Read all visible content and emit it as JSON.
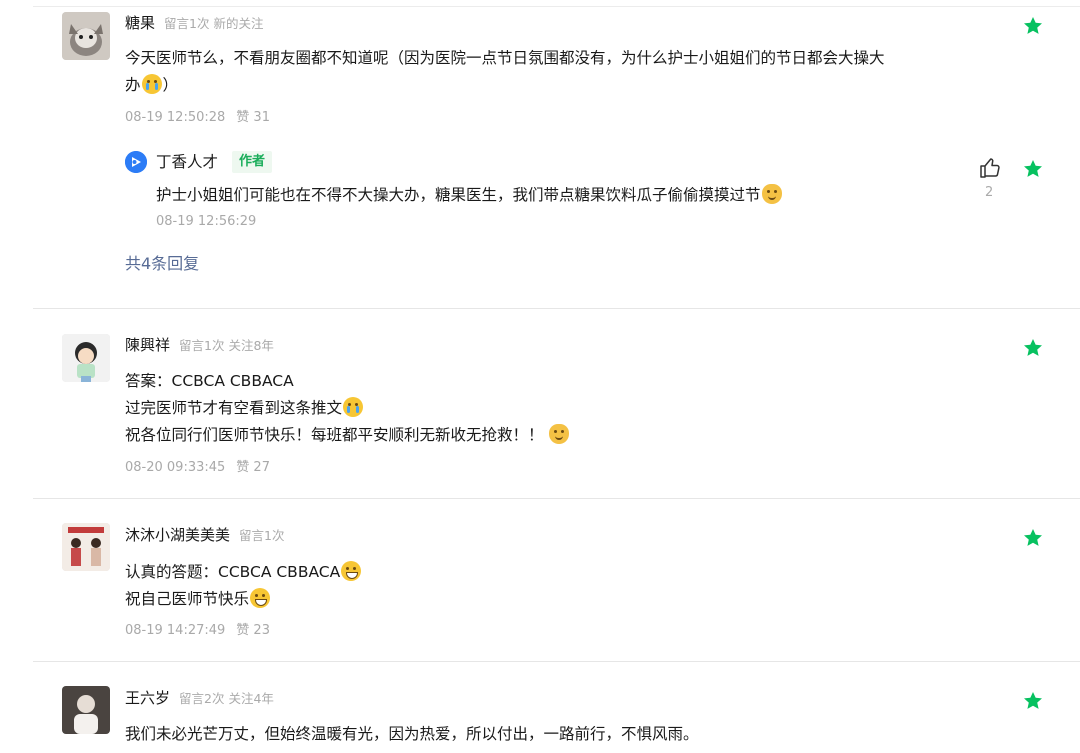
{
  "comments": [
    {
      "nickname": "糖果",
      "stat1": "留言1次",
      "stat2": "新的关注",
      "text_lines": [
        "今天医师节么，不看朋友圈都不知道呢（因为医院一点节日氛围都没有，为什么护士小姐姐们的节日都会大操大",
        "办"
      ],
      "line2_tail": "）",
      "time": "08-19 12:50:28",
      "likes": "赞 31",
      "reply": {
        "name": "丁香人才",
        "badge": "作者",
        "text": "护士小姐姐们可能也在不得不大操大办，糖果医生，我们带点糖果饮料瓜子偷偷摸摸过节",
        "time": "08-19 12:56:29",
        "like_count": "2"
      },
      "more_replies": "共4条回复"
    },
    {
      "nickname": "陳興祥",
      "stat1": "留言1次",
      "stat2": "关注8年",
      "line1": "答案：CCBCA  CBBACA",
      "line2": " 过完医师节才有空看到这条推文",
      "line3": "祝各位同行们医师节快乐！每班都平安顺利无新收无抢救！！",
      "time": "08-20 09:33:45",
      "likes": "赞 27"
    },
    {
      "nickname": "沐沐小湖美美美",
      "stat1": "留言1次",
      "line1": "认真的答题：CCBCA  CBBACA",
      "line2": "祝自己医师节快乐",
      "time": "08-19 14:27:49",
      "likes": "赞 23"
    },
    {
      "nickname": "王六岁",
      "stat1": "留言2次",
      "stat2": "关注4年",
      "line1": "我们未必光芒万丈，但始终温暖有光，因为热爱，所以付出，一路前行，不惧风雨。"
    }
  ],
  "icons": {
    "star": "star-icon",
    "thumb": "thumbs-up-icon",
    "emoji_cry": "crying-emoji-icon",
    "emoji_grin": "grin-emoji-icon",
    "emoji_cat": "cat-face-icon"
  },
  "colors": {
    "star": "#07c160",
    "author_badge": "#1aad5a",
    "link": "#576b95",
    "meta": "#a9a9a9"
  }
}
